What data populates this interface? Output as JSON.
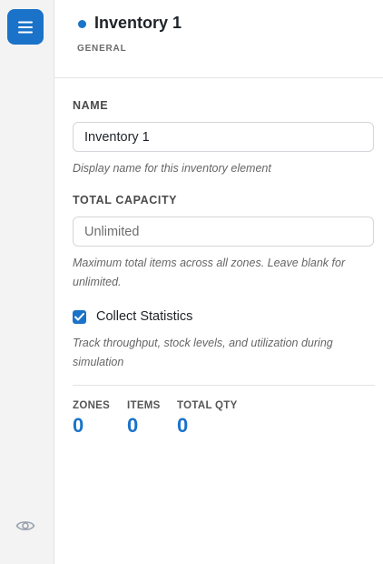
{
  "rail": {
    "menu_icon": "hamburger-menu-icon",
    "visibility_icon": "eye-icon"
  },
  "header": {
    "title": "Inventory 1",
    "subtitle": "GENERAL",
    "status_color": "#1a73c9"
  },
  "fields": {
    "name": {
      "label": "NAME",
      "value": "Inventory 1",
      "help": "Display name for this inventory element"
    },
    "total_capacity": {
      "label": "TOTAL CAPACITY",
      "value": "",
      "placeholder": "Unlimited",
      "help": "Maximum total items across all zones. Leave blank for unlimited."
    },
    "collect_statistics": {
      "label": "Collect Statistics",
      "checked": true,
      "help": "Track throughput, stock levels, and utilization during simulation"
    }
  },
  "stats": [
    {
      "label": "ZONES",
      "value": "0"
    },
    {
      "label": "ITEMS",
      "value": "0"
    },
    {
      "label": "TOTAL QTY",
      "value": "0"
    }
  ],
  "colors": {
    "accent": "#1a73c9",
    "rail_bg": "#f3f3f3"
  }
}
